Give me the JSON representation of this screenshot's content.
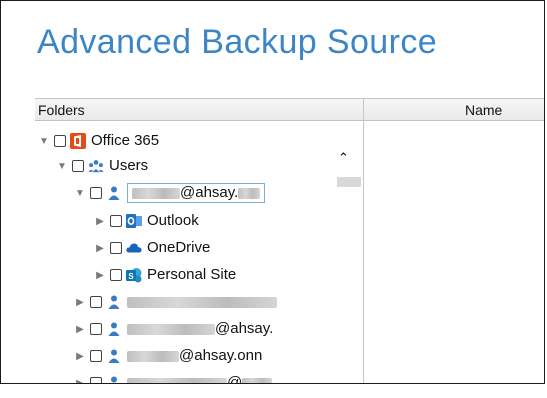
{
  "title": "Advanced Backup Source",
  "columns": {
    "folders": "Folders",
    "name": "Name"
  },
  "tree": {
    "root": "Office 365",
    "users": "Users",
    "user1_suffix": "@ahsay.",
    "apps": [
      "Outlook",
      "OneDrive",
      "Personal Site"
    ],
    "user3_suffix": "@ahsay.",
    "user4_suffix": "@ahsay.onn",
    "user5_suffix": "@"
  },
  "colors": {
    "accent": "#3d86c6",
    "office": "#e64a19",
    "outlook": "#1f6fc5",
    "onedrive": "#1565c0",
    "sharepoint": "#0b78b3",
    "users": "#3a7bc8"
  },
  "icons": [
    "office365-icon",
    "users-icon",
    "user-icon",
    "outlook-icon",
    "onedrive-icon",
    "sharepoint-icon"
  ]
}
